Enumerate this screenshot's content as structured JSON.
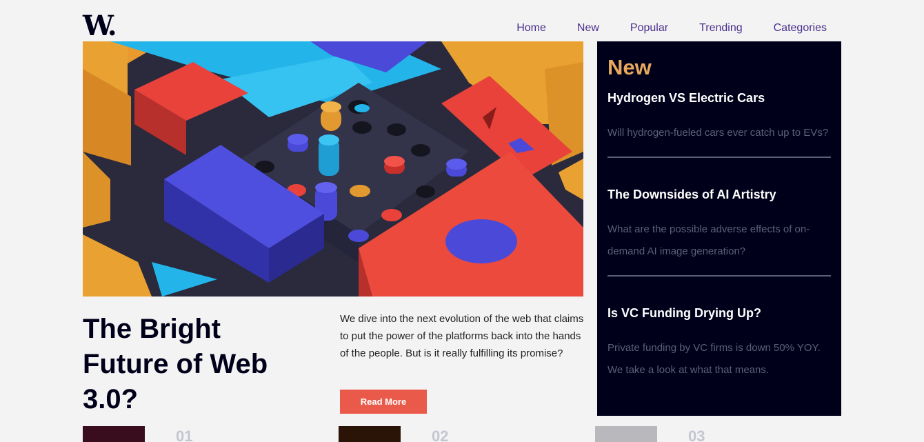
{
  "logo": "W.",
  "nav": {
    "items": [
      "Home",
      "New",
      "Popular",
      "Trending",
      "Categories"
    ]
  },
  "hero": {
    "title": "The Bright Future of Web 3.0?",
    "summary": "We dive into the next evolution of the web that claims to put the power of the platforms back into the hands of the people. But is it really fulfilling its promise?",
    "button": "Read More"
  },
  "sidebar": {
    "heading": "New",
    "articles": [
      {
        "title": "Hydrogen VS Electric Cars",
        "desc": "Will hydrogen-fueled cars ever catch up to EVs?"
      },
      {
        "title": "The Downsides of AI Artistry",
        "desc": "What are the possible adverse effects of on-demand AI image generation?"
      },
      {
        "title": "Is VC Funding Drying Up?",
        "desc": "Private funding by VC firms is down 50% YOY. We take a look at what that means."
      }
    ]
  },
  "bottom": {
    "numbers": [
      "01",
      "02",
      "03"
    ]
  },
  "colors": {
    "accent": "#ea5a4b",
    "sidebar_bg": "#00001a",
    "sidebar_heading": "#e9a85b",
    "nav_link": "#4b2f8c"
  }
}
